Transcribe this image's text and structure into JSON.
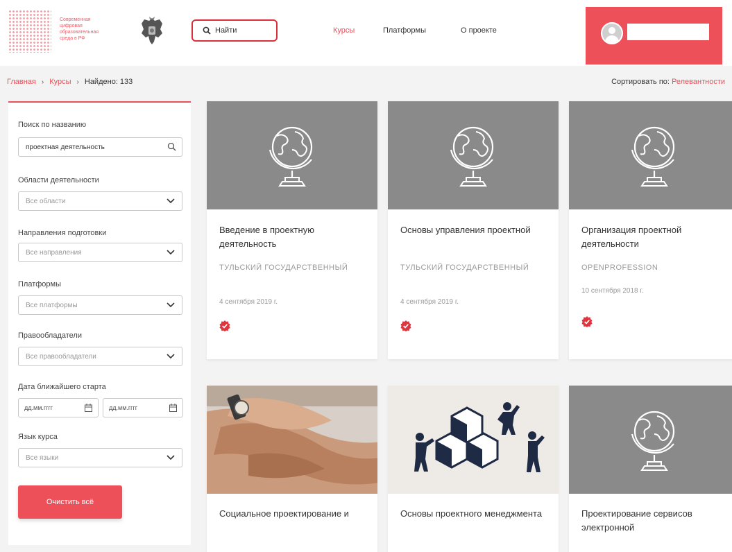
{
  "header": {
    "logo_lines": [
      "Современная",
      "цифровая",
      "образовательная",
      "среда в РФ"
    ],
    "search_label": "Найти",
    "nav": {
      "courses": "Курсы",
      "platforms": "Платформы",
      "about": "О проекте"
    },
    "colors": {
      "accent": "#e8505b",
      "user_box": "#ee505a"
    }
  },
  "breadcrumb": {
    "home": "Главная",
    "courses": "Курсы",
    "found": "Найдено: 133"
  },
  "sort": {
    "label": "Сортировать по: ",
    "value": "Релевантности"
  },
  "filters": {
    "title_search": {
      "label": "Поиск по названию",
      "value": "проектная деятельность"
    },
    "areas": {
      "label": "Области деятельности",
      "value": "Все области"
    },
    "directions": {
      "label": "Направления подготовки",
      "value": "Все направления"
    },
    "platforms": {
      "label": "Платформы",
      "value": "Все платформы"
    },
    "owners": {
      "label": "Правообладатели",
      "value": "Все правообладатели"
    },
    "start_date": {
      "label": "Дата ближайшего старта",
      "from_placeholder": "дд.мм.гггг",
      "to_placeholder": "дд.мм.гггг"
    },
    "language": {
      "label": "Язык курса",
      "value": "Все языки"
    },
    "clear_button": "Очистить всё"
  },
  "cards": [
    {
      "title": "Введение в проектную деятельность",
      "org": "ТУЛЬСКИЙ ГОСУДАРСТВЕННЫЙ",
      "date": "4 сентября 2019 г.",
      "image": "globe-icon"
    },
    {
      "title": "Основы управления проектной",
      "org": "ТУЛЬСКИЙ ГОСУДАРСТВЕННЫЙ",
      "date": "4 сентября 2019 г.",
      "image": "globe-icon"
    },
    {
      "title": "Организация проектной деятельности",
      "org": "OPENPROFESSION",
      "date": "10 сентября 2018 г.",
      "image": "globe-icon"
    },
    {
      "title": "Социальное проектирование и",
      "image": "hands-photo"
    },
    {
      "title": "Основы проектного менеджмента",
      "image": "cubes-people-illustration"
    },
    {
      "title": "Проектирование сервисов электронной",
      "image": "globe-icon"
    }
  ]
}
